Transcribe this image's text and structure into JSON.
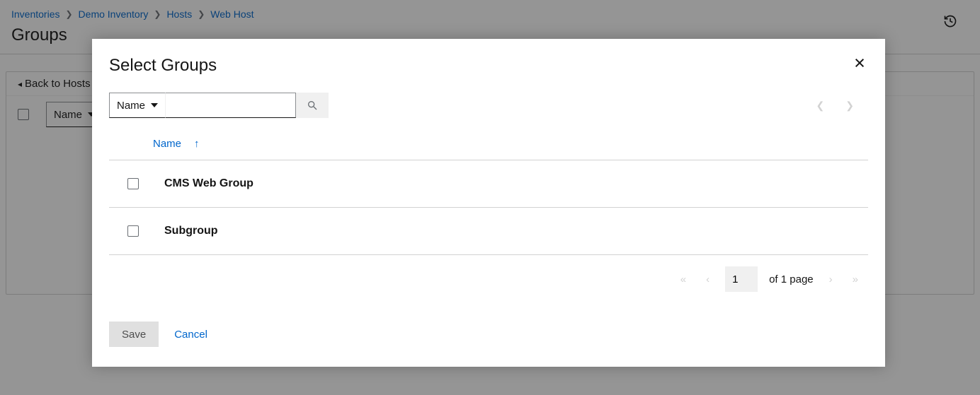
{
  "breadcrumb": [
    {
      "label": "Inventories"
    },
    {
      "label": "Demo Inventory"
    },
    {
      "label": "Hosts"
    },
    {
      "label": "Web Host"
    }
  ],
  "page_title": "Groups",
  "back_link": "Back to Hosts",
  "bg_filter_label": "Name",
  "modal": {
    "title": "Select Groups",
    "filter_field": "Name",
    "search_value": "",
    "columns": {
      "name": "Name"
    },
    "rows": [
      {
        "name": "CMS Web Group"
      },
      {
        "name": "Subgroup"
      }
    ],
    "pager": {
      "current": "1",
      "suffix": "of 1 page"
    },
    "buttons": {
      "save": "Save",
      "cancel": "Cancel"
    }
  }
}
